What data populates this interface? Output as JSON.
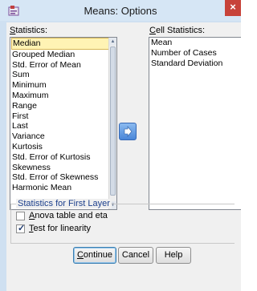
{
  "window": {
    "title": "Means: Options",
    "close_symbol": "×",
    "icon": "spss-dialog-icon"
  },
  "statistics": {
    "label_mnemonic": "S",
    "label_rest": "tatistics:",
    "items": [
      "Median",
      "Grouped Median",
      "Std. Error of Mean",
      "Sum",
      "Minimum",
      "Maximum",
      "Range",
      "First",
      "Last",
      "Variance",
      "Kurtosis",
      "Std. Error of Kurtosis",
      "Skewness",
      "Std. Error of Skewness",
      "Harmonic Mean"
    ],
    "selected_index": 0
  },
  "cell_statistics": {
    "label_mnemonic": "C",
    "label_rest": "ell Statistics:",
    "items": [
      "Mean",
      "Number of Cases",
      "Standard Deviation"
    ]
  },
  "move_button": {
    "icon": "right-arrow-icon"
  },
  "first_layer": {
    "title": "Statistics for First Layer",
    "anova": {
      "mnemonic": "A",
      "rest": "nova table and eta",
      "checked": false
    },
    "linearity": {
      "mnemonic": "T",
      "rest": "est for linearity",
      "checked": true
    }
  },
  "buttons": {
    "continue_mnemonic": "C",
    "continue_rest": "ontinue",
    "cancel": "Cancel",
    "help": "Help"
  },
  "colors": {
    "selection_fill": "#fff3b4",
    "selection_border": "#d6b656",
    "group_title": "#1c3f8c",
    "close": "#c7433a"
  }
}
